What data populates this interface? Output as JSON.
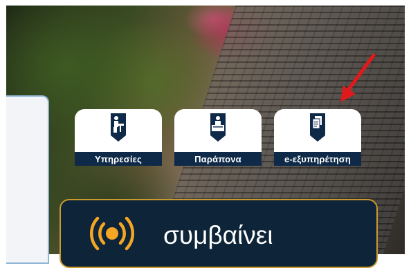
{
  "tiles": [
    {
      "label": "Υπηρεσίες",
      "icon": "office-worker-icon"
    },
    {
      "label": "Παράπονα",
      "icon": "reception-desk-icon"
    },
    {
      "label": "e-εξυπηρέτηση",
      "icon": "documents-icon"
    }
  ],
  "notice": {
    "text": "συμβαίνει",
    "icon": "broadcast-icon"
  },
  "colors": {
    "navy": "#0f2a48",
    "gold": "#c99a2e",
    "arrow": "#e01a1a",
    "icon_orange": "#f5a623"
  }
}
